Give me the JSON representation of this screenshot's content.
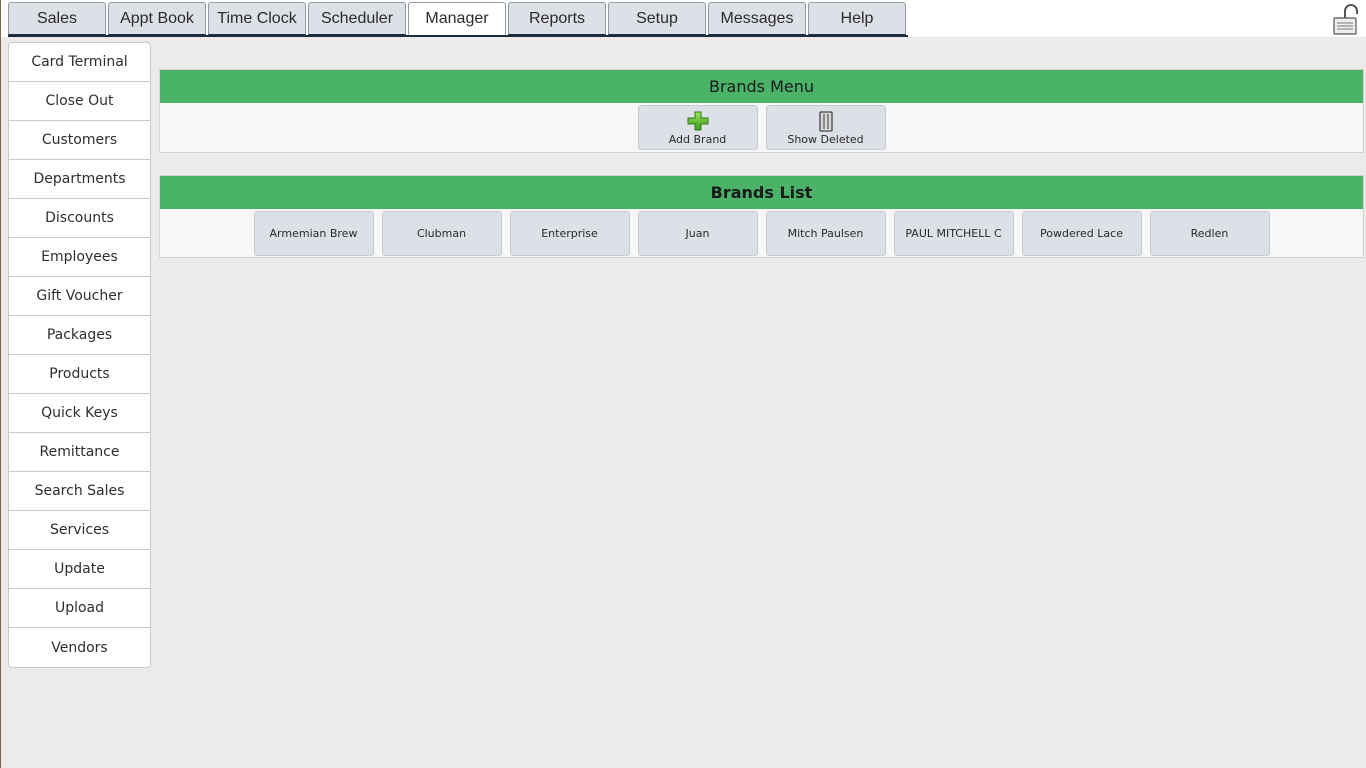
{
  "top_tabs": [
    {
      "label": "Sales",
      "active": false
    },
    {
      "label": "Appt Book",
      "active": false
    },
    {
      "label": "Time Clock",
      "active": false
    },
    {
      "label": "Scheduler",
      "active": false
    },
    {
      "label": "Manager",
      "active": true
    },
    {
      "label": "Reports",
      "active": false
    },
    {
      "label": "Setup",
      "active": false
    },
    {
      "label": "Messages",
      "active": false
    },
    {
      "label": "Help",
      "active": false
    }
  ],
  "lock_icon": "unlocked-register-icon",
  "sidebar": {
    "items": [
      {
        "label": "Card Terminal"
      },
      {
        "label": "Close Out"
      },
      {
        "label": "Customers"
      },
      {
        "label": "Departments"
      },
      {
        "label": "Discounts"
      },
      {
        "label": "Employees"
      },
      {
        "label": "Gift Voucher"
      },
      {
        "label": "Packages"
      },
      {
        "label": "Products"
      },
      {
        "label": "Quick Keys"
      },
      {
        "label": "Remittance"
      },
      {
        "label": "Search Sales"
      },
      {
        "label": "Services"
      },
      {
        "label": "Update"
      },
      {
        "label": "Upload"
      },
      {
        "label": "Vendors"
      }
    ]
  },
  "brands_menu": {
    "title": "Brands Menu",
    "add_label": "Add Brand",
    "add_icon": "green-plus-icon",
    "deleted_label": "Show Deleted",
    "deleted_icon": "trash-can-icon"
  },
  "brands_list": {
    "title": "Brands List",
    "brands": [
      "Armemian Brew",
      "Clubman",
      "Enterprise",
      "Juan",
      "Mitch Paulsen",
      "PAUL MITCHELL C",
      "Powdered Lace",
      "Redlen"
    ]
  },
  "colors": {
    "header_green": "#4bb367",
    "button_bg": "#dde0e6",
    "page_bg": "#ecebe9"
  }
}
